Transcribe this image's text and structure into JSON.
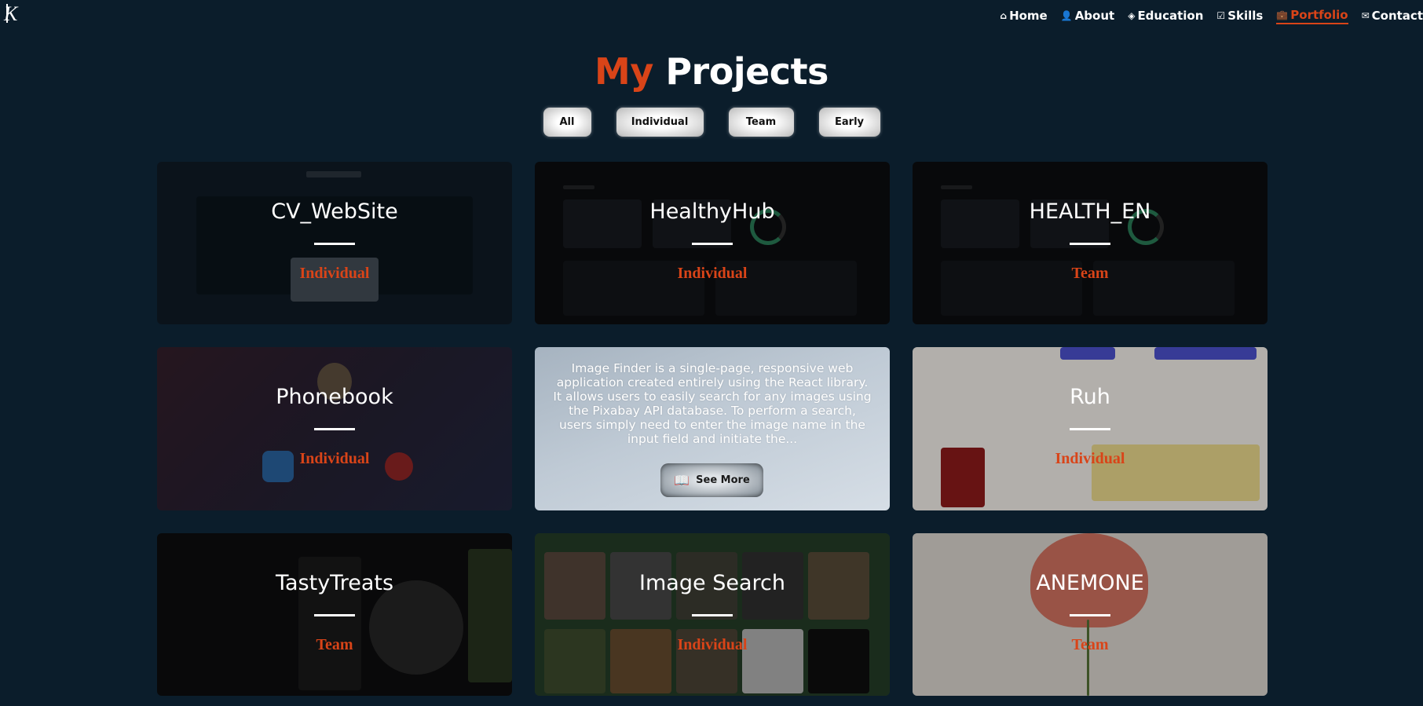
{
  "nav": {
    "items": [
      {
        "icon": "⌂",
        "label": "Home"
      },
      {
        "icon": "👤",
        "label": "About"
      },
      {
        "icon": "◈",
        "label": "Education"
      },
      {
        "icon": "☑",
        "label": "Skills"
      },
      {
        "icon": "💼",
        "label": "Portfolio"
      },
      {
        "icon": "✉",
        "label": "Contact"
      }
    ],
    "active": "Portfolio"
  },
  "page": {
    "title_accent": "My",
    "title_rest": "Projects"
  },
  "filters": [
    "All",
    "Individual",
    "Team",
    "Early"
  ],
  "projects": [
    {
      "name": "CV_WebSite",
      "tag": "Individual"
    },
    {
      "name": "HealthyHub",
      "tag": "Individual"
    },
    {
      "name": "HEALTH_EN",
      "tag": "Team"
    },
    {
      "name": "Phonebook",
      "tag": "Individual"
    },
    {
      "description": "Image Finder is a single-page, responsive web application created entirely using the React library. It allows users to easily search for any images using the Pixabay API database. To perform a search, users simply need to enter the image name in the input field and initiate the...",
      "button": "See More"
    },
    {
      "name": "Ruh",
      "tag": "Individual"
    },
    {
      "name": "TastyTreats",
      "tag": "Team"
    },
    {
      "name": "Image Search",
      "tag": "Individual"
    },
    {
      "name": "ANEMONE",
      "tag": "Team"
    }
  ],
  "colors": {
    "background": "#0b1d2b",
    "accent": "#d94418"
  }
}
